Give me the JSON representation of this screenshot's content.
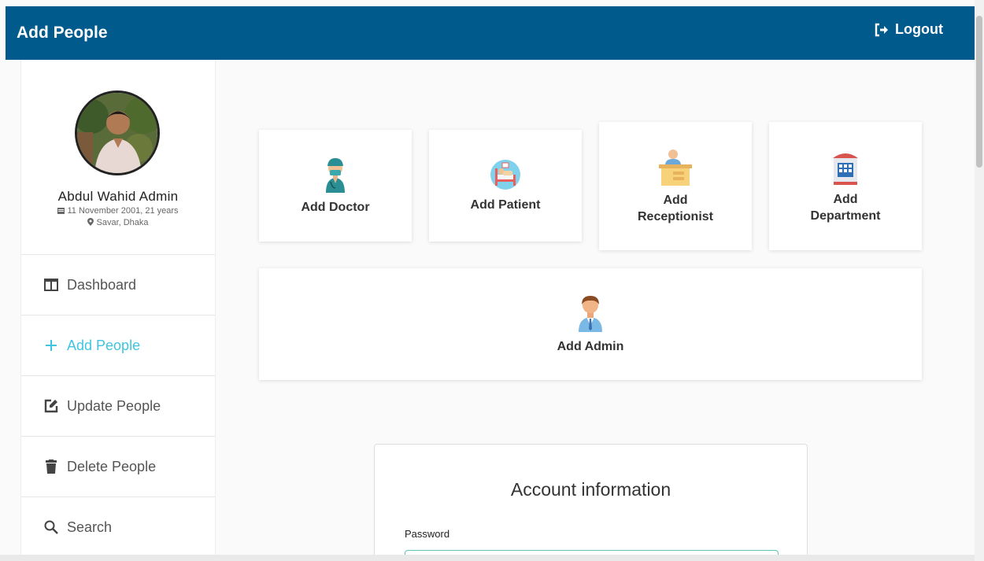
{
  "header": {
    "title": "Add People",
    "logout_label": "Logout"
  },
  "profile": {
    "name": "Abdul Wahid Admin",
    "dob": "11 November 2001, 21 years",
    "location": "Savar, Dhaka"
  },
  "sidebar": {
    "items": [
      {
        "label": "Dashboard",
        "icon": "columns-icon"
      },
      {
        "label": "Add People",
        "icon": "plus-icon",
        "active": true
      },
      {
        "label": "Update People",
        "icon": "edit-icon"
      },
      {
        "label": "Delete People",
        "icon": "trash-icon"
      },
      {
        "label": "Search",
        "icon": "search-icon"
      }
    ]
  },
  "cards": {
    "doctor": "Add Doctor",
    "patient": "Add Patient",
    "receptionist_1": "Add",
    "receptionist_2": "Receptionist",
    "department_1": "Add",
    "department_2": "Department",
    "admin": "Add Admin"
  },
  "account": {
    "title": "Account information",
    "password_label": "Password",
    "password_value": ""
  },
  "colors": {
    "header": "#005a8c",
    "active_nav": "#3ec6e0",
    "input_border": "#5fc3b6"
  }
}
